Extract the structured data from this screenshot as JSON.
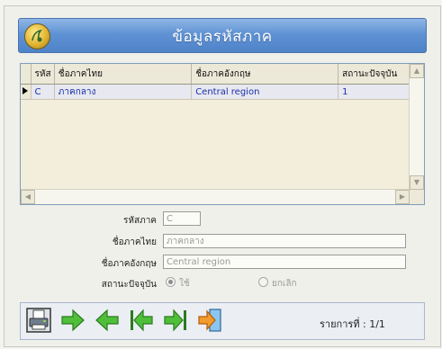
{
  "header": {
    "title": "ข้อมูลรหัสภาค"
  },
  "grid": {
    "columns": [
      "รหัส",
      "ชื่อภาคไทย",
      "ชื่อภาคอังกฤษ",
      "สถานะปัจจุบัน"
    ],
    "rows": [
      {
        "code": "C",
        "name_th": "ภาคกลาง",
        "name_en": "Central region",
        "status": "1"
      }
    ]
  },
  "form": {
    "code_label": "รหัสภาค",
    "code_value": "C",
    "name_th_label": "ชื่อภาคไทย",
    "name_th_value": "ภาคกลาง",
    "name_en_label": "ชื่อภาคอังกฤษ",
    "name_en_value": "Central region",
    "status_label": "สถานะปัจจุบัน",
    "status_options": [
      "ใช้",
      "ยกเลิก"
    ],
    "status_selected": "ใช้"
  },
  "toolbar": {
    "buttons": [
      "print-icon",
      "next-arrow-icon",
      "prev-arrow-icon",
      "first-record-icon",
      "last-record-icon",
      "exit-icon"
    ],
    "record_text": "รายการที่ : 1/1"
  },
  "colors": {
    "header_blue": "#5f92d4",
    "arrow_green": "#4fbf3a",
    "exit_orange": "#e8861c"
  }
}
